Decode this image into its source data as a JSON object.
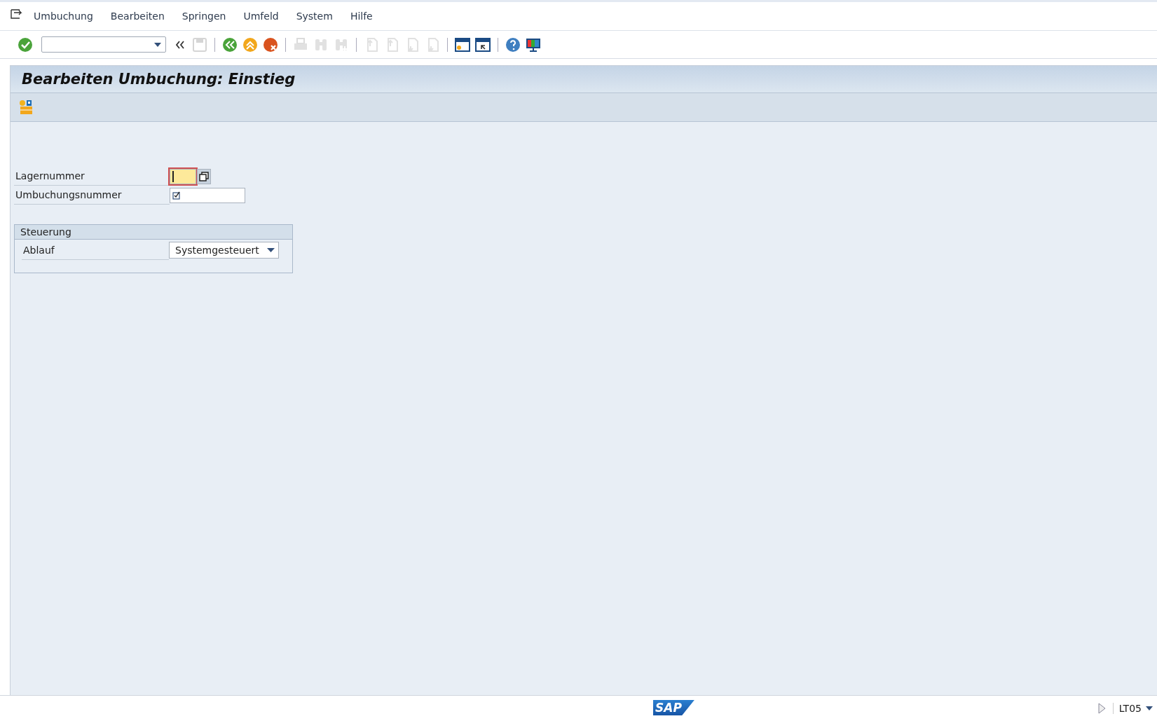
{
  "menu": [
    {
      "label": "Umbuchung"
    },
    {
      "label": "Bearbeiten"
    },
    {
      "label": "Springen"
    },
    {
      "label": "Umfeld"
    },
    {
      "label": "System"
    },
    {
      "label": "Hilfe"
    }
  ],
  "toolbar": [
    [
      {
        "kind": "enter",
        "disabled": false
      },
      {
        "kind": "command",
        "disabled": false
      },
      {
        "kind": "collapse",
        "disabled": false
      },
      {
        "kind": "save",
        "disabled": true
      }
    ],
    [
      {
        "kind": "back",
        "disabled": false
      },
      {
        "kind": "exit",
        "disabled": false
      },
      {
        "kind": "cancel",
        "disabled": false
      }
    ],
    [
      {
        "kind": "print",
        "disabled": true
      },
      {
        "kind": "find",
        "disabled": true
      },
      {
        "kind": "findnext",
        "disabled": true
      }
    ],
    [
      {
        "kind": "first",
        "disabled": true
      },
      {
        "kind": "prev",
        "disabled": true
      },
      {
        "kind": "next",
        "disabled": true
      },
      {
        "kind": "last",
        "disabled": true
      }
    ],
    [
      {
        "kind": "newsession",
        "disabled": false
      },
      {
        "kind": "shortcut",
        "disabled": false
      }
    ],
    [
      {
        "kind": "help",
        "disabled": false
      },
      {
        "kind": "layout",
        "disabled": false
      }
    ]
  ],
  "title": "Bearbeiten Umbuchung: Einstieg",
  "fields": [
    {
      "label": "Lagernummer",
      "kind": "help-input",
      "focused": true
    },
    {
      "label": "Umbuchungsnummer",
      "kind": "required-input",
      "focused": false
    }
  ],
  "group": {
    "title": "Steuerung",
    "fields": [
      {
        "label": "Ablauf",
        "kind": "dropdown",
        "value": "Systemgesteuert"
      }
    ]
  },
  "status_bar": {
    "logo": "SAP",
    "transaction": "LT05"
  }
}
